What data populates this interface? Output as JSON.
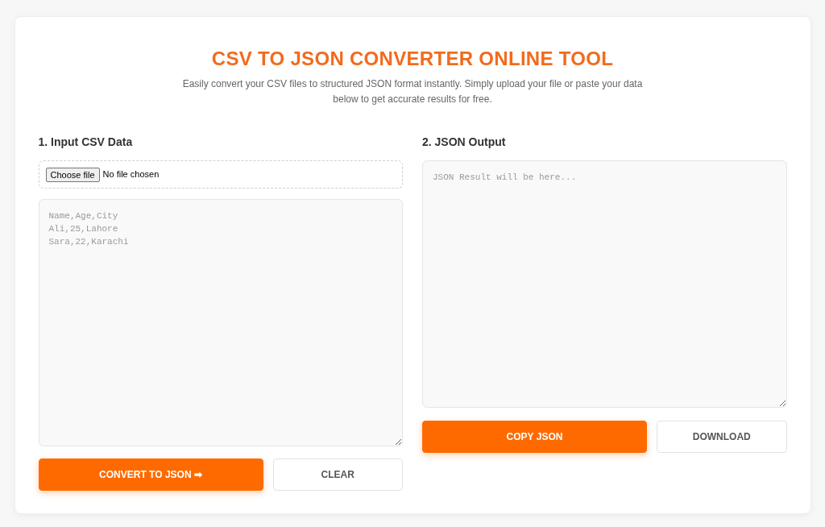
{
  "header": {
    "title": "CSV TO JSON CONVERTER ONLINE TOOL",
    "subtitle": "Easily convert your CSV files to structured JSON format instantly. Simply upload your file or paste your data below to get accurate results for free."
  },
  "input_panel": {
    "heading": "1. Input CSV Data",
    "file_picker": {
      "button": "Choose file",
      "status": "No file chosen"
    },
    "textarea": {
      "placeholder": "Name,Age,City\nAli,25,Lahore\nSara,22,Karachi"
    },
    "buttons": [
      {
        "label": "CONVERT TO JSON ➡",
        "kind": "primary"
      },
      {
        "label": "CLEAR",
        "kind": "secondary"
      }
    ]
  },
  "output_panel": {
    "heading": "2. JSON Output",
    "textarea": {
      "placeholder": "JSON Result will be here..."
    },
    "buttons": [
      {
        "label": "COPY JSON",
        "kind": "primary"
      },
      {
        "label": "DOWNLOAD",
        "kind": "secondary"
      }
    ]
  }
}
